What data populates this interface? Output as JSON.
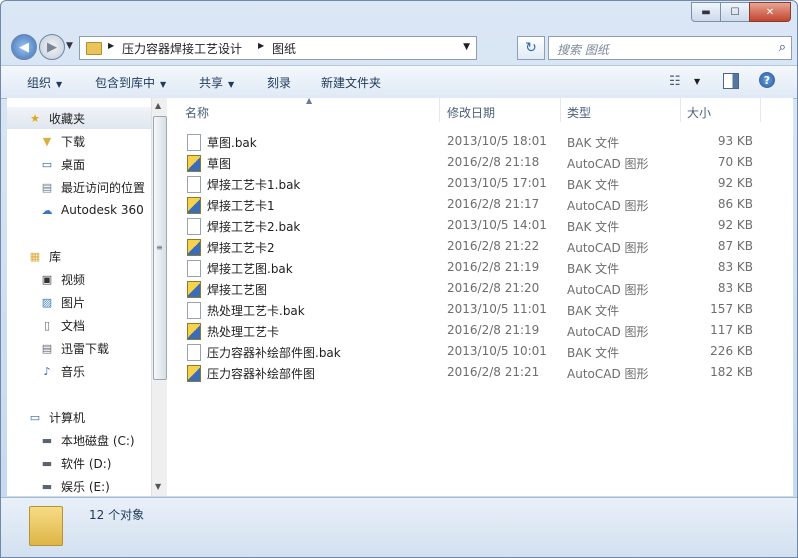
{
  "window": {
    "min_symbol": "▬",
    "max_symbol": "☐",
    "close_symbol": "✕"
  },
  "nav": {
    "back_symbol": "◀",
    "forward_symbol": "▶",
    "breadcrumbs": [
      "压力容器焊接工艺设计",
      "图纸"
    ],
    "search_placeholder": "搜索 图纸"
  },
  "toolbar": {
    "organize": "组织",
    "include_in_library": "包含到库中",
    "share": "共享",
    "burn": "刻录",
    "new_folder": "新建文件夹"
  },
  "sidebar": {
    "favorites_header": "收藏夹",
    "favorites": [
      "下载",
      "桌面",
      "最近访问的位置",
      "Autodesk 360"
    ],
    "libraries_header": "库",
    "libraries": [
      "视频",
      "图片",
      "文档",
      "迅雷下载",
      "音乐"
    ],
    "computer_header": "计算机",
    "drives": [
      "本地磁盘 (C:)",
      "软件 (D:)",
      "娱乐 (E:)"
    ]
  },
  "columns": {
    "name": "名称",
    "date": "修改日期",
    "type": "类型",
    "size": "大小"
  },
  "files": [
    {
      "name": "草图.bak",
      "date": "2013/10/5 18:01",
      "type": "BAK 文件",
      "size": "93 KB",
      "icon": "bak"
    },
    {
      "name": "草图",
      "date": "2016/2/8 21:18",
      "type": "AutoCAD 图形",
      "size": "70 KB",
      "icon": "dwg"
    },
    {
      "name": "焊接工艺卡1.bak",
      "date": "2013/10/5 17:01",
      "type": "BAK 文件",
      "size": "92 KB",
      "icon": "bak"
    },
    {
      "name": "焊接工艺卡1",
      "date": "2016/2/8 21:17",
      "type": "AutoCAD 图形",
      "size": "86 KB",
      "icon": "dwg"
    },
    {
      "name": "焊接工艺卡2.bak",
      "date": "2013/10/5 14:01",
      "type": "BAK 文件",
      "size": "92 KB",
      "icon": "bak"
    },
    {
      "name": "焊接工艺卡2",
      "date": "2016/2/8 21:22",
      "type": "AutoCAD 图形",
      "size": "87 KB",
      "icon": "dwg"
    },
    {
      "name": "焊接工艺图.bak",
      "date": "2016/2/8 21:19",
      "type": "BAK 文件",
      "size": "83 KB",
      "icon": "bak"
    },
    {
      "name": "焊接工艺图",
      "date": "2016/2/8 21:20",
      "type": "AutoCAD 图形",
      "size": "83 KB",
      "icon": "dwg"
    },
    {
      "name": "热处理工艺卡.bak",
      "date": "2013/10/5 11:01",
      "type": "BAK 文件",
      "size": "157 KB",
      "icon": "bak"
    },
    {
      "name": "热处理工艺卡",
      "date": "2016/2/8 21:19",
      "type": "AutoCAD 图形",
      "size": "117 KB",
      "icon": "dwg"
    },
    {
      "name": "压力容器补绘部件图.bak",
      "date": "2013/10/5 10:01",
      "type": "BAK 文件",
      "size": "226 KB",
      "icon": "bak"
    },
    {
      "name": "压力容器补绘部件图",
      "date": "2016/2/8 21:21",
      "type": "AutoCAD 图形",
      "size": "182 KB",
      "icon": "dwg"
    }
  ],
  "status": {
    "count": "12 个对象"
  }
}
